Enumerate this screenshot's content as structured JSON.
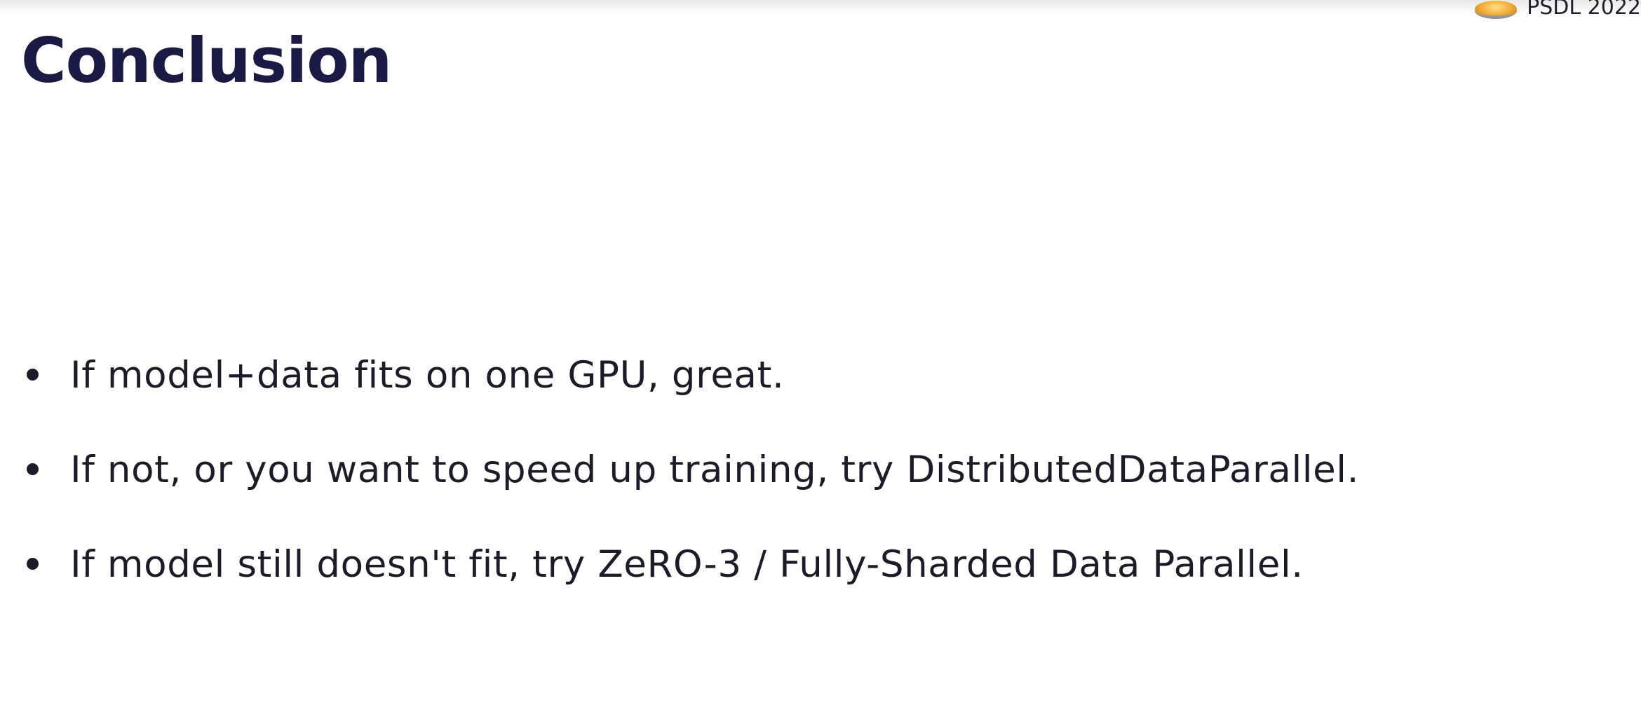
{
  "slide": {
    "title": "Conclusion",
    "badge_text": "PSDL 2022",
    "bullets": [
      "If model+data fits on one GPU, great.",
      "If not, or you want to speed up training, try DistributedDataParallel.",
      "If model still doesn't fit, try ZeRO-3 / Fully-Sharded Data Parallel."
    ]
  },
  "colors": {
    "title": "#1a1a45",
    "body_text": "#1c1c28",
    "background": "#ffffff"
  },
  "icons": {
    "badge_logo": "pancake-stack-icon"
  }
}
